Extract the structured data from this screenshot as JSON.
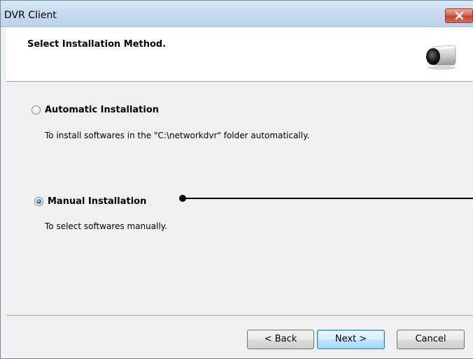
{
  "window": {
    "title": "DVR Client"
  },
  "header": {
    "title": "Select Installation Method."
  },
  "options": [
    {
      "label": "Automatic Installation",
      "description": "To install softwares in the \"C:\\networkdvr\" folder automatically.",
      "selected": false
    },
    {
      "label": "Manual Installation",
      "description": "To select softwares manually.",
      "selected": true
    }
  ],
  "buttons": {
    "back": "< Back",
    "next": "Next >",
    "cancel": "Cancel"
  },
  "icons": {
    "close": "close-icon",
    "logo": "camera-icon"
  },
  "colors": {
    "titlebar": "#c8daef",
    "close": "#c24633",
    "accent": "#1f6fd0"
  }
}
